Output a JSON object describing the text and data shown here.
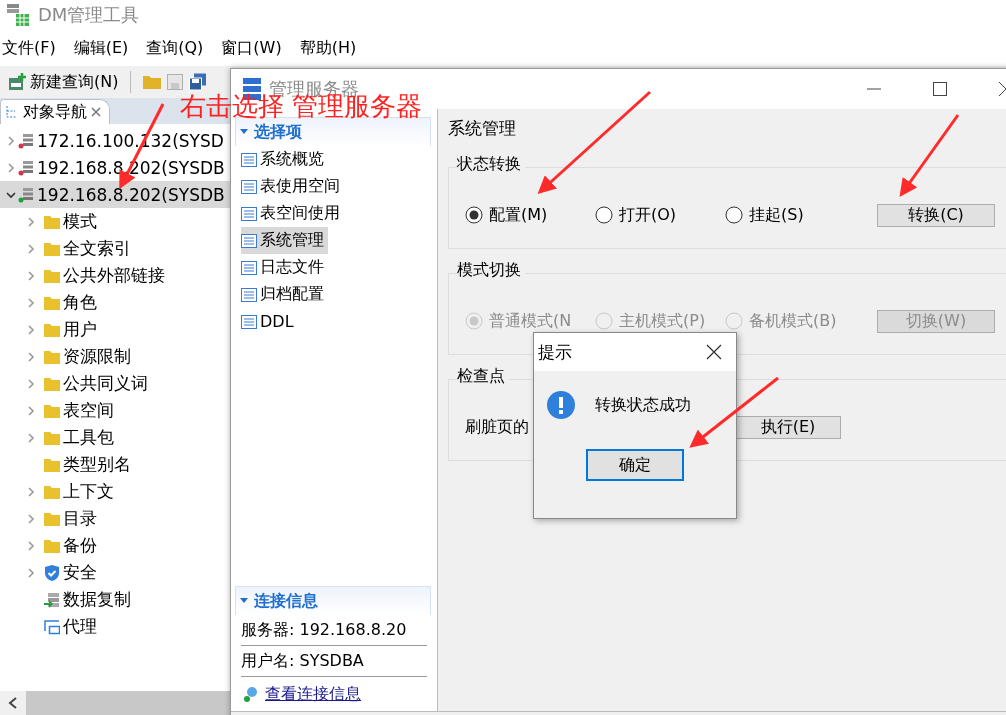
{
  "main_window": {
    "title": "DM管理工具"
  },
  "menu": [
    "文件(F)",
    "编辑(E)",
    "查询(Q)",
    "窗口(W)",
    "帮助(H)"
  ],
  "toolbar": {
    "new_query": "新建查询(N)"
  },
  "nav_tab": {
    "label": "对象导航"
  },
  "tree": [
    {
      "label": "172.16.100.132(SYSD",
      "connected": false,
      "expanded": false,
      "selected": false
    },
    {
      "label": "192.168.8.202(SYSDB",
      "connected": false,
      "expanded": false,
      "selected": false
    },
    {
      "label": "192.168.8.202(SYSDB",
      "connected": true,
      "expanded": true,
      "selected": true,
      "children": [
        {
          "label": "模式",
          "kind": "folder",
          "expandable": true
        },
        {
          "label": "全文索引",
          "kind": "folder",
          "expandable": true
        },
        {
          "label": "公共外部链接",
          "kind": "folder",
          "expandable": true
        },
        {
          "label": "角色",
          "kind": "folder",
          "expandable": true
        },
        {
          "label": "用户",
          "kind": "folder",
          "expandable": true
        },
        {
          "label": "资源限制",
          "kind": "folder",
          "expandable": true
        },
        {
          "label": "公共同义词",
          "kind": "folder",
          "expandable": true
        },
        {
          "label": "表空间",
          "kind": "folder",
          "expandable": true
        },
        {
          "label": "工具包",
          "kind": "folder",
          "expandable": true
        },
        {
          "label": "类型别名",
          "kind": "folder",
          "expandable": false
        },
        {
          "label": "上下文",
          "kind": "folder",
          "expandable": true
        },
        {
          "label": "目录",
          "kind": "folder",
          "expandable": true
        },
        {
          "label": "备份",
          "kind": "folder",
          "expandable": true
        },
        {
          "label": "安全",
          "kind": "shield",
          "expandable": true
        },
        {
          "label": "数据复制",
          "kind": "replication",
          "expandable": false
        },
        {
          "label": "代理",
          "kind": "proxy",
          "expandable": false
        }
      ]
    }
  ],
  "dialog": {
    "title": "管理服务器",
    "options_header": "选择项",
    "options": [
      {
        "label": "系统概览",
        "selected": false
      },
      {
        "label": "表使用空间",
        "selected": false
      },
      {
        "label": "表空间使用",
        "selected": false
      },
      {
        "label": "系统管理",
        "selected": true
      },
      {
        "label": "日志文件",
        "selected": false
      },
      {
        "label": "归档配置",
        "selected": false
      },
      {
        "label": "DDL",
        "selected": false
      }
    ],
    "connection_header": "连接信息",
    "server": "服务器: 192.168.8.20",
    "user": "用户名: SYSDBA",
    "link": "查看连接信息",
    "page_title": "系统管理",
    "groups": [
      {
        "title": "状态转换",
        "disabled": false,
        "radios": [
          {
            "label": "配置(M)",
            "selected": true
          },
          {
            "label": "打开(O)",
            "selected": false
          },
          {
            "label": "挂起(S)",
            "selected": false
          }
        ],
        "button": "转换(C)"
      },
      {
        "title": "模式切换",
        "disabled": true,
        "radios": [
          {
            "label": "普通模式(N",
            "selected": true
          },
          {
            "label": "主机模式(P)",
            "selected": false
          },
          {
            "label": "备机模式(B)",
            "selected": false
          }
        ],
        "button": "切换(W)"
      },
      {
        "title": "检查点",
        "disabled": false,
        "label": "刷脏页的",
        "button": "执行(E)"
      }
    ]
  },
  "message_box": {
    "title": "提示",
    "message": "转换状态成功",
    "ok": "确定"
  },
  "annotation": {
    "text": "右击选择 管理服务器"
  }
}
